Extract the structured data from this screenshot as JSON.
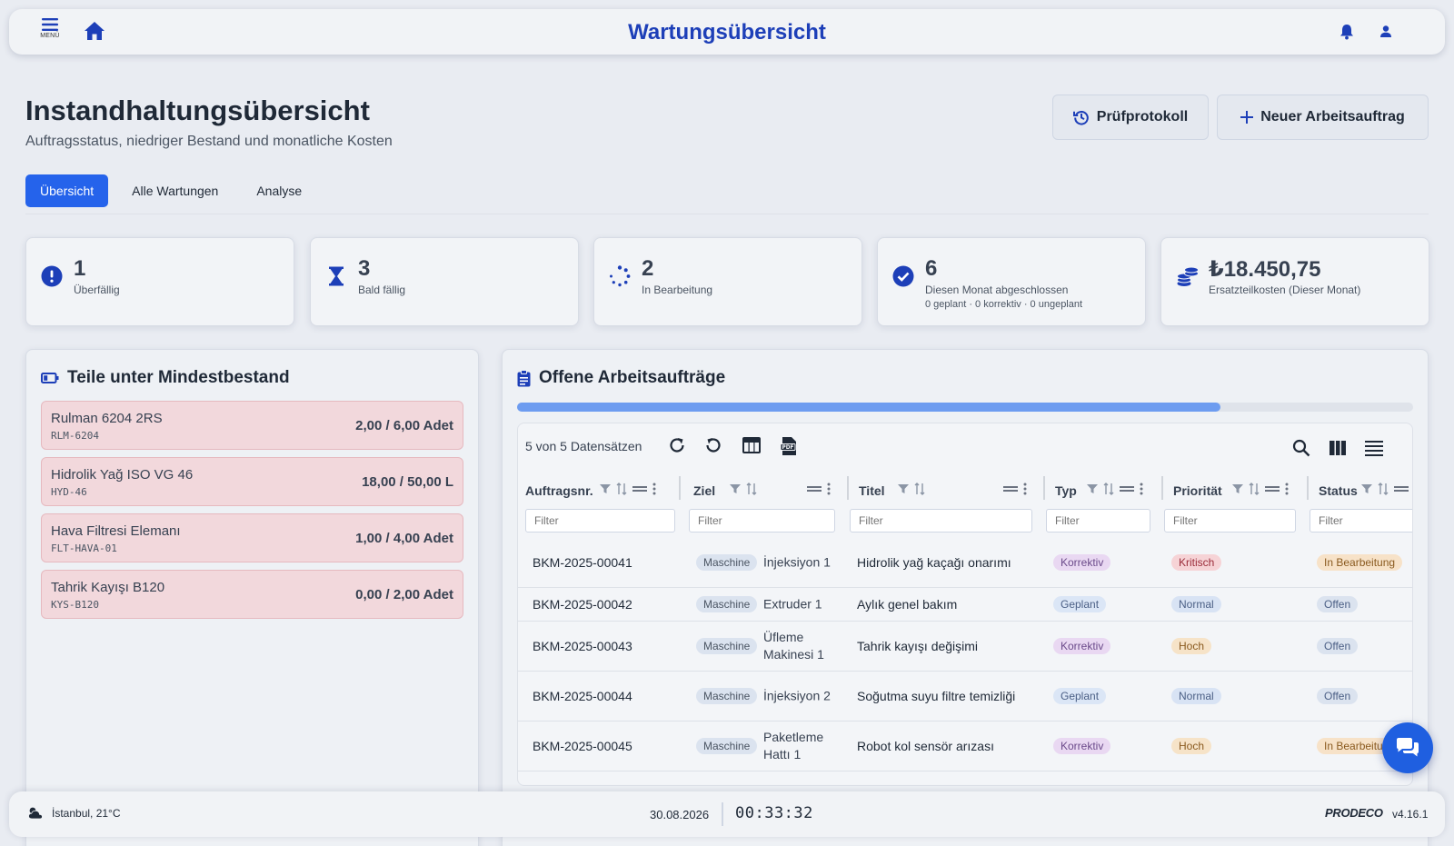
{
  "topbar": {
    "menu_label": "MENÜ",
    "title": "Wartungsübersicht"
  },
  "header": {
    "title": "Instandhaltungsübersicht",
    "subtitle": "Auftragsstatus, niedriger Bestand und monatliche Kosten",
    "protocol_button": "Prüfprotokoll",
    "new_button": "Neuer Arbeitsauftrag"
  },
  "tabs": [
    {
      "label": "Übersicht",
      "active": true
    },
    {
      "label": "Alle Wartungen",
      "active": false
    },
    {
      "label": "Analyse",
      "active": false
    }
  ],
  "kpis": [
    {
      "value": "1",
      "label": "Überfällig",
      "icon": "exclamation-circle-icon"
    },
    {
      "value": "3",
      "label": "Bald fällig",
      "icon": "hourglass-icon"
    },
    {
      "value": "2",
      "label": "In Bearbeitung",
      "icon": "spinner-icon"
    },
    {
      "value": "6",
      "label": "Diesen Monat abgeschlossen",
      "sub": "0 geplant · 0 korrektiv · 0 ungeplant",
      "icon": "check-circle-icon"
    },
    {
      "value": "₺18.450,75",
      "label": "Ersatzteilkosten (Dieser Monat)",
      "icon": "coins-icon"
    }
  ],
  "low_stock": {
    "title": "Teile unter Mindestbestand",
    "items": [
      {
        "name": "Rulman 6204 2RS",
        "code": "RLM-6204",
        "qty": "2,00 / 6,00 Adet"
      },
      {
        "name": "Hidrolik Yağ ISO VG 46",
        "code": "HYD-46",
        "qty": "18,00 / 50,00 L"
      },
      {
        "name": "Hava Filtresi Elemanı",
        "code": "FLT-HAVA-01",
        "qty": "1,00 / 4,00 Adet"
      },
      {
        "name": "Tahrik Kayışı B120",
        "code": "KYS-B120",
        "qty": "0,00 / 2,00 Adet"
      }
    ]
  },
  "work_orders": {
    "title": "Offene Arbeitsaufträge",
    "progress": 0.785,
    "record_count": "5 von 5 Datensätzen",
    "columns": [
      "Auftragsnr.",
      "Ziel",
      "Titel",
      "Typ",
      "Priorität",
      "Status"
    ],
    "filter_placeholder": "Filter",
    "rows": [
      {
        "id": "BKM-2025-00041",
        "target_type": "Maschine",
        "target": "İnjeksiyon 1",
        "title": "Hidrolik yağ kaçağı onarımı",
        "type": "Korrektiv",
        "priority": "Kritisch",
        "status": "In Bearbeitung"
      },
      {
        "id": "BKM-2025-00042",
        "target_type": "Maschine",
        "target": "Extruder 1",
        "title": "Aylık genel bakım",
        "type": "Geplant",
        "priority": "Normal",
        "status": "Offen"
      },
      {
        "id": "BKM-2025-00043",
        "target_type": "Maschine",
        "target": "Üfleme Makinesi 1",
        "title": "Tahrik kayışı değişimi",
        "type": "Korrektiv",
        "priority": "Hoch",
        "status": "Offen"
      },
      {
        "id": "BKM-2025-00044",
        "target_type": "Maschine",
        "target": "İnjeksiyon 2",
        "title": "Soğutma suyu filtre temizliği",
        "type": "Geplant",
        "priority": "Normal",
        "status": "Offen"
      },
      {
        "id": "BKM-2025-00045",
        "target_type": "Maschine",
        "target": "Paketleme Hattı 1",
        "title": "Robot kol sensör arızası",
        "type": "Korrektiv",
        "priority": "Hoch",
        "status": "In Bearbeitung"
      }
    ]
  },
  "footer": {
    "weather": "İstanbul, 21°C",
    "date": "30.08.2026",
    "time": "00:33:32",
    "logo": "PRODECO",
    "version": "v4.16.1"
  },
  "colors": {
    "accent": "#2563eb",
    "title_blue": "#1d3fb8",
    "danger_bg": "#f2d8dc"
  }
}
